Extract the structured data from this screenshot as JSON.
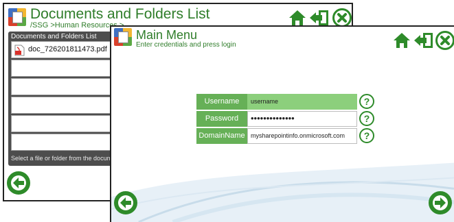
{
  "back_window": {
    "title": "Documents and Folders List",
    "breadcrumb": "/SSG >Human Resources >",
    "list": {
      "header": "Documents and Folders List",
      "items": [
        {
          "name": "doc_726201811473.pdf",
          "icon": "pdf-icon"
        },
        {
          "name": ""
        },
        {
          "name": ""
        },
        {
          "name": ""
        },
        {
          "name": ""
        },
        {
          "name": ""
        }
      ],
      "footer": "Select a file or folder from the docum"
    }
  },
  "front_window": {
    "title": "Main Menu",
    "subtitle": "Enter credentials and press login",
    "form": {
      "username_label": "Username",
      "username_value": "username",
      "password_label": "Password",
      "password_value": "••••••••••••••",
      "domain_label": "DomainName",
      "domain_value": "mysharepointinfo.onmicrosoft.com",
      "help_glyph": "?"
    }
  },
  "colors": {
    "accent_green": "#2e8b2a",
    "label_green": "#66b057",
    "active_field": "#8ccf7c",
    "panel_dark": "#4d4d4d"
  },
  "icons": [
    "home-icon",
    "exit-icon",
    "close-icon",
    "back-arrow-icon",
    "next-arrow-icon",
    "help-icon",
    "pdf-icon",
    "app-logo-icon"
  ]
}
